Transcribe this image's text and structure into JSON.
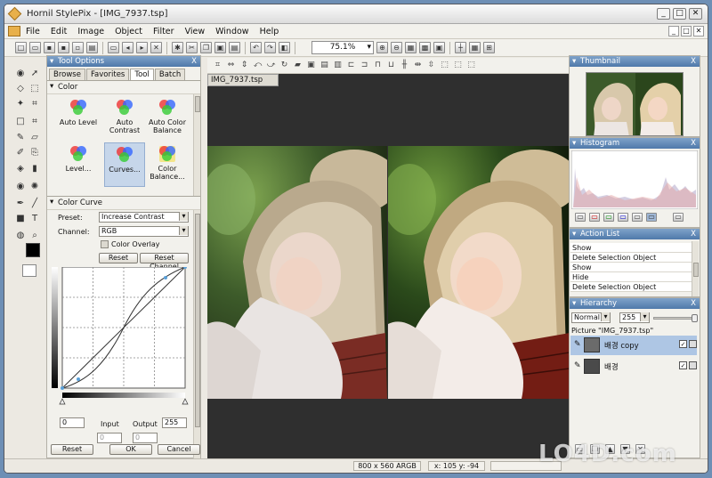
{
  "window": {
    "title": "Hornil StylePix - [IMG_7937.tsp]",
    "controls": [
      "_",
      "□",
      "✕"
    ]
  },
  "menu": [
    "File",
    "Edit",
    "Image",
    "Object",
    "Filter",
    "View",
    "Window",
    "Help"
  ],
  "toolbar": {
    "zoom": "75.1%"
  },
  "tool_options": {
    "title": "Tool Options",
    "tabs": [
      "Browse",
      "Favorites",
      "Tool",
      "Batch"
    ],
    "active_tab": "Tool",
    "section_color": "Color",
    "effects": [
      "Auto Level",
      "Auto Contrast",
      "Auto Color Balance",
      "Level...",
      "Curves...",
      "Color Balance..."
    ],
    "selected_effect": "Curves...",
    "curve_section": "Color Curve",
    "preset_label": "Preset:",
    "preset_value": "Increase Contrast",
    "channel_label": "Channel:",
    "channel_value": "RGB",
    "overlay_label": "Color Overlay",
    "reset_label": "Reset",
    "reset_channel_label": "Reset Channel",
    "input_label": "Input",
    "output_label": "Output",
    "input_value": "0",
    "output_value": "0",
    "left_value": "0",
    "right_value": "255",
    "bottom_reset": "Reset",
    "ok": "OK",
    "cancel": "Cancel"
  },
  "document": {
    "tab": "IMG_7937.tsp"
  },
  "thumbnail": {
    "title": "Thumbnail"
  },
  "histogram": {
    "title": "Histogram"
  },
  "action_list": {
    "title": "Action List",
    "items": [
      "Show",
      "Delete Selection Object",
      "Show",
      "Hide",
      "Delete Selection Object"
    ]
  },
  "hierarchy": {
    "title": "Hierarchy",
    "blend": "Normal",
    "opacity": "255",
    "picture": "Picture \"IMG_7937.tsp\"",
    "layers": [
      "배경 copy",
      "배경"
    ]
  },
  "status": {
    "size": "800 x 560 ARGB",
    "coords": "x: 105 y: -94"
  },
  "watermark": "LO4D.com",
  "colors": {
    "panel_title": "#5b82b1",
    "selection": "#aec6e4",
    "canvas_bg": "#2f2f2f"
  }
}
